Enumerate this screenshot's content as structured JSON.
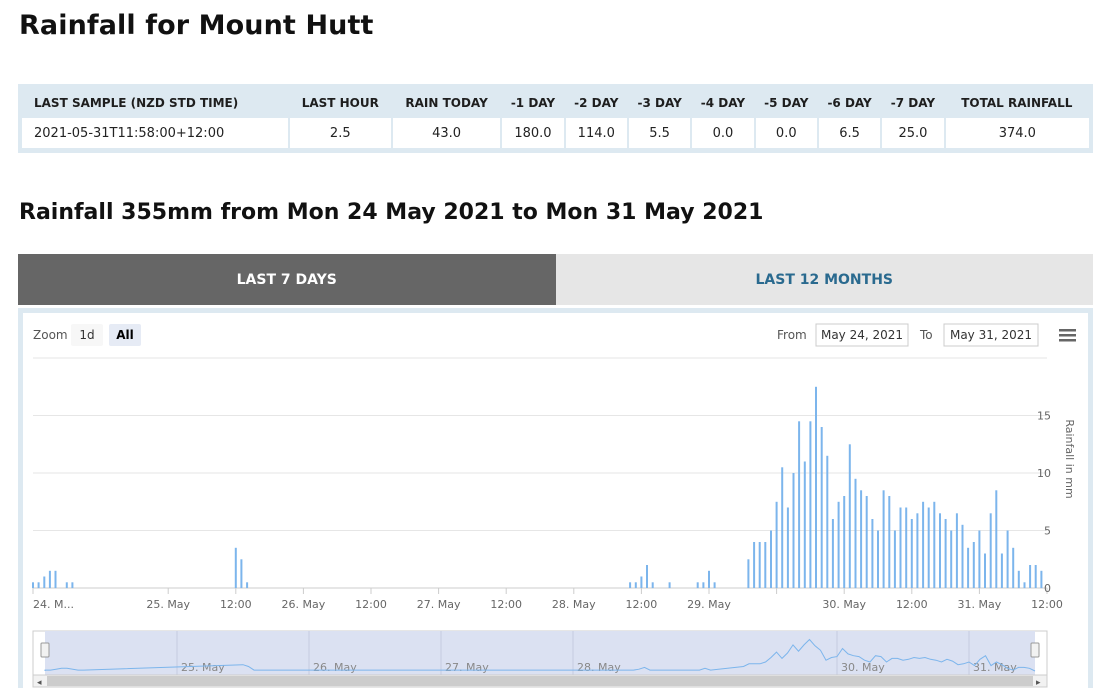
{
  "page": {
    "title": "Rainfall for Mount Hutt",
    "subtitle": "Rainfall 355mm from Mon 24 May 2021 to Mon 31 May 2021"
  },
  "summary": {
    "headers": [
      "LAST SAMPLE (NZD STD TIME)",
      "LAST HOUR",
      "RAIN TODAY",
      "-1 DAY",
      "-2 DAY",
      "-3 DAY",
      "-4 DAY",
      "-5 DAY",
      "-6 DAY",
      "-7 DAY",
      "TOTAL RAINFALL"
    ],
    "row": [
      "2021-05-31T11:58:00+12:00",
      "2.5",
      "43.0",
      "180.0",
      "114.0",
      "5.5",
      "0.0",
      "0.0",
      "6.5",
      "25.0",
      "374.0"
    ]
  },
  "tabs": [
    {
      "label": "LAST 7 DAYS",
      "active": true
    },
    {
      "label": "LAST 12 MONTHS",
      "active": false
    }
  ],
  "controls": {
    "zoom_label": "Zoom",
    "zoom_options": [
      {
        "label": "1d",
        "selected": false
      },
      {
        "label": "All",
        "selected": true
      }
    ],
    "from_label": "From",
    "from_value": "May 24, 2021",
    "to_label": "To",
    "to_value": "May 31, 2021",
    "menu_icon": "hamburger-menu-icon"
  },
  "colors": {
    "bar": "#7cb5ec",
    "accent_tab": "#666666",
    "navigator": "#dbe1f2"
  },
  "chart_data": {
    "type": "bar",
    "title": "",
    "xlabel": "",
    "ylabel": "Rainfall in mm",
    "ylim": [
      0,
      20
    ],
    "y_ticks": [
      0,
      5,
      10,
      15
    ],
    "y_axis_side": "right",
    "grid": true,
    "x_start": "2021-05-24T00:00",
    "x_end": "2021-05-31T12:00",
    "x_ticks": [
      {
        "t": "2021-05-24T00:00",
        "label": "24. M..."
      },
      {
        "t": "2021-05-25T00:00",
        "label": "25. May"
      },
      {
        "t": "2021-05-25T12:00",
        "label": "12:00"
      },
      {
        "t": "2021-05-26T00:00",
        "label": "26. May"
      },
      {
        "t": "2021-05-26T12:00",
        "label": "12:00"
      },
      {
        "t": "2021-05-27T00:00",
        "label": "27. May"
      },
      {
        "t": "2021-05-27T12:00",
        "label": "12:00"
      },
      {
        "t": "2021-05-28T00:00",
        "label": "28. May"
      },
      {
        "t": "2021-05-28T12:00",
        "label": "12:00"
      },
      {
        "t": "2021-05-29T00:00",
        "label": "29. May"
      },
      {
        "t": "2021-05-29T12:00",
        "label": ""
      },
      {
        "t": "2021-05-30T00:00",
        "label": "30. May"
      },
      {
        "t": "2021-05-30T12:00",
        "label": "12:00"
      },
      {
        "t": "2021-05-31T00:00",
        "label": "31. May"
      },
      {
        "t": "2021-05-31T12:00",
        "label": "12:00"
      }
    ],
    "navigator_labels": [
      {
        "t": "2021-05-25T00:00",
        "label": "25. May"
      },
      {
        "t": "2021-05-26T00:00",
        "label": "26. May"
      },
      {
        "t": "2021-05-27T00:00",
        "label": "27. May"
      },
      {
        "t": "2021-05-28T00:00",
        "label": "28. May"
      },
      {
        "t": "2021-05-30T00:00",
        "label": "30. May"
      },
      {
        "t": "2021-05-31T00:00",
        "label": "31. May"
      }
    ],
    "points": [
      {
        "t": "2021-05-24T00:00",
        "v": 0.5
      },
      {
        "t": "2021-05-24T01:00",
        "v": 0.5
      },
      {
        "t": "2021-05-24T02:00",
        "v": 1.0
      },
      {
        "t": "2021-05-24T03:00",
        "v": 1.5
      },
      {
        "t": "2021-05-24T04:00",
        "v": 1.5
      },
      {
        "t": "2021-05-24T06:00",
        "v": 0.5
      },
      {
        "t": "2021-05-24T07:00",
        "v": 0.5
      },
      {
        "t": "2021-05-25T12:00",
        "v": 3.5
      },
      {
        "t": "2021-05-25T13:00",
        "v": 2.5
      },
      {
        "t": "2021-05-25T14:00",
        "v": 0.5
      },
      {
        "t": "2021-05-28T10:00",
        "v": 0.5
      },
      {
        "t": "2021-05-28T11:00",
        "v": 0.5
      },
      {
        "t": "2021-05-28T12:00",
        "v": 1.0
      },
      {
        "t": "2021-05-28T13:00",
        "v": 2.0
      },
      {
        "t": "2021-05-28T14:00",
        "v": 0.5
      },
      {
        "t": "2021-05-28T17:00",
        "v": 0.5
      },
      {
        "t": "2021-05-28T22:00",
        "v": 0.5
      },
      {
        "t": "2021-05-28T23:00",
        "v": 0.5
      },
      {
        "t": "2021-05-29T00:00",
        "v": 1.5
      },
      {
        "t": "2021-05-29T01:00",
        "v": 0.5
      },
      {
        "t": "2021-05-29T07:00",
        "v": 2.5
      },
      {
        "t": "2021-05-29T08:00",
        "v": 4.0
      },
      {
        "t": "2021-05-29T09:00",
        "v": 4.0
      },
      {
        "t": "2021-05-29T10:00",
        "v": 4.0
      },
      {
        "t": "2021-05-29T11:00",
        "v": 5.0
      },
      {
        "t": "2021-05-29T12:00",
        "v": 7.5
      },
      {
        "t": "2021-05-29T13:00",
        "v": 10.5
      },
      {
        "t": "2021-05-29T14:00",
        "v": 7.0
      },
      {
        "t": "2021-05-29T15:00",
        "v": 10.0
      },
      {
        "t": "2021-05-29T16:00",
        "v": 14.5
      },
      {
        "t": "2021-05-29T17:00",
        "v": 11.0
      },
      {
        "t": "2021-05-29T18:00",
        "v": 14.5
      },
      {
        "t": "2021-05-29T19:00",
        "v": 17.5
      },
      {
        "t": "2021-05-29T20:00",
        "v": 14.0
      },
      {
        "t": "2021-05-29T21:00",
        "v": 11.5
      },
      {
        "t": "2021-05-29T22:00",
        "v": 6.0
      },
      {
        "t": "2021-05-29T23:00",
        "v": 7.5
      },
      {
        "t": "2021-05-30T00:00",
        "v": 8.0
      },
      {
        "t": "2021-05-30T01:00",
        "v": 12.5
      },
      {
        "t": "2021-05-30T02:00",
        "v": 9.5
      },
      {
        "t": "2021-05-30T03:00",
        "v": 8.5
      },
      {
        "t": "2021-05-30T04:00",
        "v": 8.0
      },
      {
        "t": "2021-05-30T05:00",
        "v": 6.0
      },
      {
        "t": "2021-05-30T06:00",
        "v": 5.0
      },
      {
        "t": "2021-05-30T07:00",
        "v": 8.5
      },
      {
        "t": "2021-05-30T08:00",
        "v": 8.0
      },
      {
        "t": "2021-05-30T09:00",
        "v": 5.0
      },
      {
        "t": "2021-05-30T10:00",
        "v": 7.0
      },
      {
        "t": "2021-05-30T11:00",
        "v": 7.0
      },
      {
        "t": "2021-05-30T12:00",
        "v": 6.0
      },
      {
        "t": "2021-05-30T13:00",
        "v": 6.5
      },
      {
        "t": "2021-05-30T14:00",
        "v": 7.5
      },
      {
        "t": "2021-05-30T15:00",
        "v": 7.0
      },
      {
        "t": "2021-05-30T16:00",
        "v": 7.5
      },
      {
        "t": "2021-05-30T17:00",
        "v": 6.5
      },
      {
        "t": "2021-05-30T18:00",
        "v": 6.0
      },
      {
        "t": "2021-05-30T19:00",
        "v": 5.0
      },
      {
        "t": "2021-05-30T20:00",
        "v": 6.5
      },
      {
        "t": "2021-05-30T21:00",
        "v": 5.5
      },
      {
        "t": "2021-05-30T22:00",
        "v": 3.5
      },
      {
        "t": "2021-05-30T23:00",
        "v": 4.0
      },
      {
        "t": "2021-05-31T00:00",
        "v": 5.0
      },
      {
        "t": "2021-05-31T01:00",
        "v": 3.0
      },
      {
        "t": "2021-05-31T02:00",
        "v": 6.5
      },
      {
        "t": "2021-05-31T03:00",
        "v": 8.5
      },
      {
        "t": "2021-05-31T04:00",
        "v": 3.0
      },
      {
        "t": "2021-05-31T05:00",
        "v": 5.0
      },
      {
        "t": "2021-05-31T06:00",
        "v": 3.5
      },
      {
        "t": "2021-05-31T07:00",
        "v": 1.5
      },
      {
        "t": "2021-05-31T08:00",
        "v": 0.5
      },
      {
        "t": "2021-05-31T09:00",
        "v": 2.0
      },
      {
        "t": "2021-05-31T10:00",
        "v": 2.0
      },
      {
        "t": "2021-05-31T11:00",
        "v": 1.5
      }
    ]
  }
}
